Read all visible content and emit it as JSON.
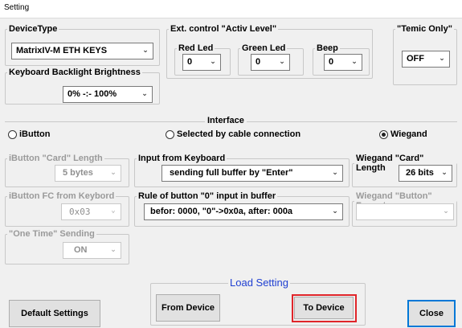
{
  "window": {
    "title": "Setting"
  },
  "device_type": {
    "legend": "DeviceType",
    "value": "MatrixIV-M ETH KEYS"
  },
  "backlight": {
    "legend": "Keyboard Backlight Brightness",
    "value": "0% -:- 100%"
  },
  "ext_control": {
    "legend": "Ext. control  \"Activ Level\"",
    "red": {
      "legend": "Red Led",
      "value": "0"
    },
    "green": {
      "legend": "Green Led",
      "value": "0"
    },
    "beep": {
      "legend": "Beep",
      "value": "0"
    }
  },
  "temic": {
    "legend": "\"Temic Only\"",
    "value": "OFF"
  },
  "interface": {
    "title": "Interface",
    "options": [
      {
        "label": "iButton",
        "selected": false
      },
      {
        "label": "Selected by cable connection",
        "selected": false
      },
      {
        "label": "Wiegand",
        "selected": true
      }
    ]
  },
  "ibutton_length": {
    "legend": "iButton \"Card\" Length",
    "value": "5 bytes"
  },
  "input_from_keyboard": {
    "legend": "Input from Keyboard",
    "value": "sending full buffer by \"Enter\""
  },
  "wiegand_length": {
    "legend": "Wiegand \"Card\" Length",
    "value": "26 bits"
  },
  "ibutton_fc": {
    "legend": "iButton FC from Keybord",
    "value": "0x03"
  },
  "rule_button0": {
    "legend": "Rule of button \"0\" input in buffer",
    "value": "befor: 0000, \"0\"->0x0a, after: 000a"
  },
  "wiegand_button_format": {
    "legend": "Wiegand \"Button\" Format",
    "value": ""
  },
  "one_time": {
    "legend": "\"One Time\" Sending",
    "value": "ON"
  },
  "load_setting": {
    "legend": "Load Setting",
    "from_device": "From Device",
    "to_device": "To Device"
  },
  "buttons": {
    "default_settings": "Default Settings",
    "close": "Close"
  },
  "colors": {
    "highlight": "#e0252a",
    "load_label": "#1f3fd1",
    "focus": "#0078d7"
  }
}
